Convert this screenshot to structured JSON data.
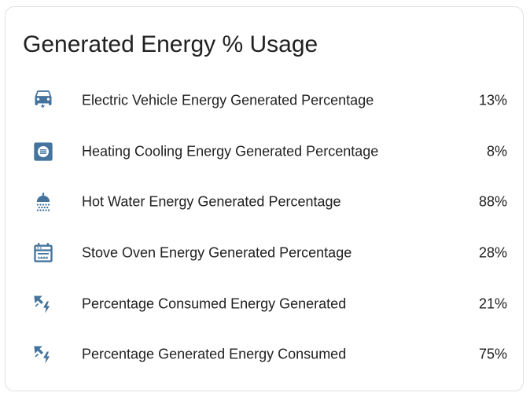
{
  "card": {
    "title": "Generated Energy % Usage"
  },
  "colors": {
    "icon": "#44739e",
    "text": "#212121",
    "border": "#e0e0e0"
  },
  "entities": [
    {
      "icon": "car-electric-icon",
      "name": "Electric Vehicle Energy Generated Percentage",
      "value": "13%"
    },
    {
      "icon": "hvac-icon",
      "name": "Heating Cooling Energy Generated Percentage",
      "value": "8%"
    },
    {
      "icon": "shower-icon",
      "name": "Hot Water Energy Generated Percentage",
      "value": "88%"
    },
    {
      "icon": "stove-icon",
      "name": "Stove Oven Energy Generated Percentage",
      "value": "28%"
    },
    {
      "icon": "transmission-tower-icon",
      "name": "Percentage Consumed Energy Generated",
      "value": "21%"
    },
    {
      "icon": "transmission-tower-icon",
      "name": "Percentage Generated Energy Consumed",
      "value": "75%"
    }
  ]
}
